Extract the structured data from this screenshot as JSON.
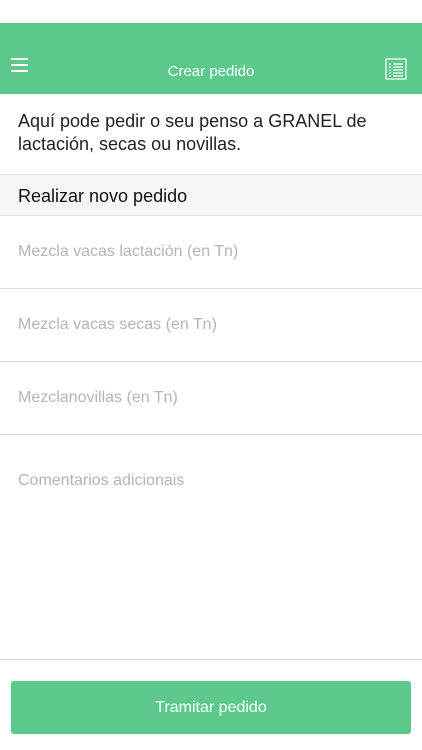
{
  "header": {
    "title": "Crear pedido",
    "menu_icon": "hamburger-menu-icon",
    "list_icon": "order-list-icon",
    "color": "#5dc88b"
  },
  "intro_text": "Aquí pode pedir o seu penso a GRANEL de lactación, secas ou novillas.",
  "section": {
    "title": "Realizar novo pedido"
  },
  "form": {
    "lactation_placeholder": "Mezcla vacas lactación (en Tn)",
    "dry_placeholder": "Mezcla vacas secas (en Tn)",
    "heifers_placeholder": "Mezclanovillas (en Tn)",
    "comments_placeholder": "Comentarios adicionais"
  },
  "submit": {
    "label": "Tramitar pedido"
  }
}
